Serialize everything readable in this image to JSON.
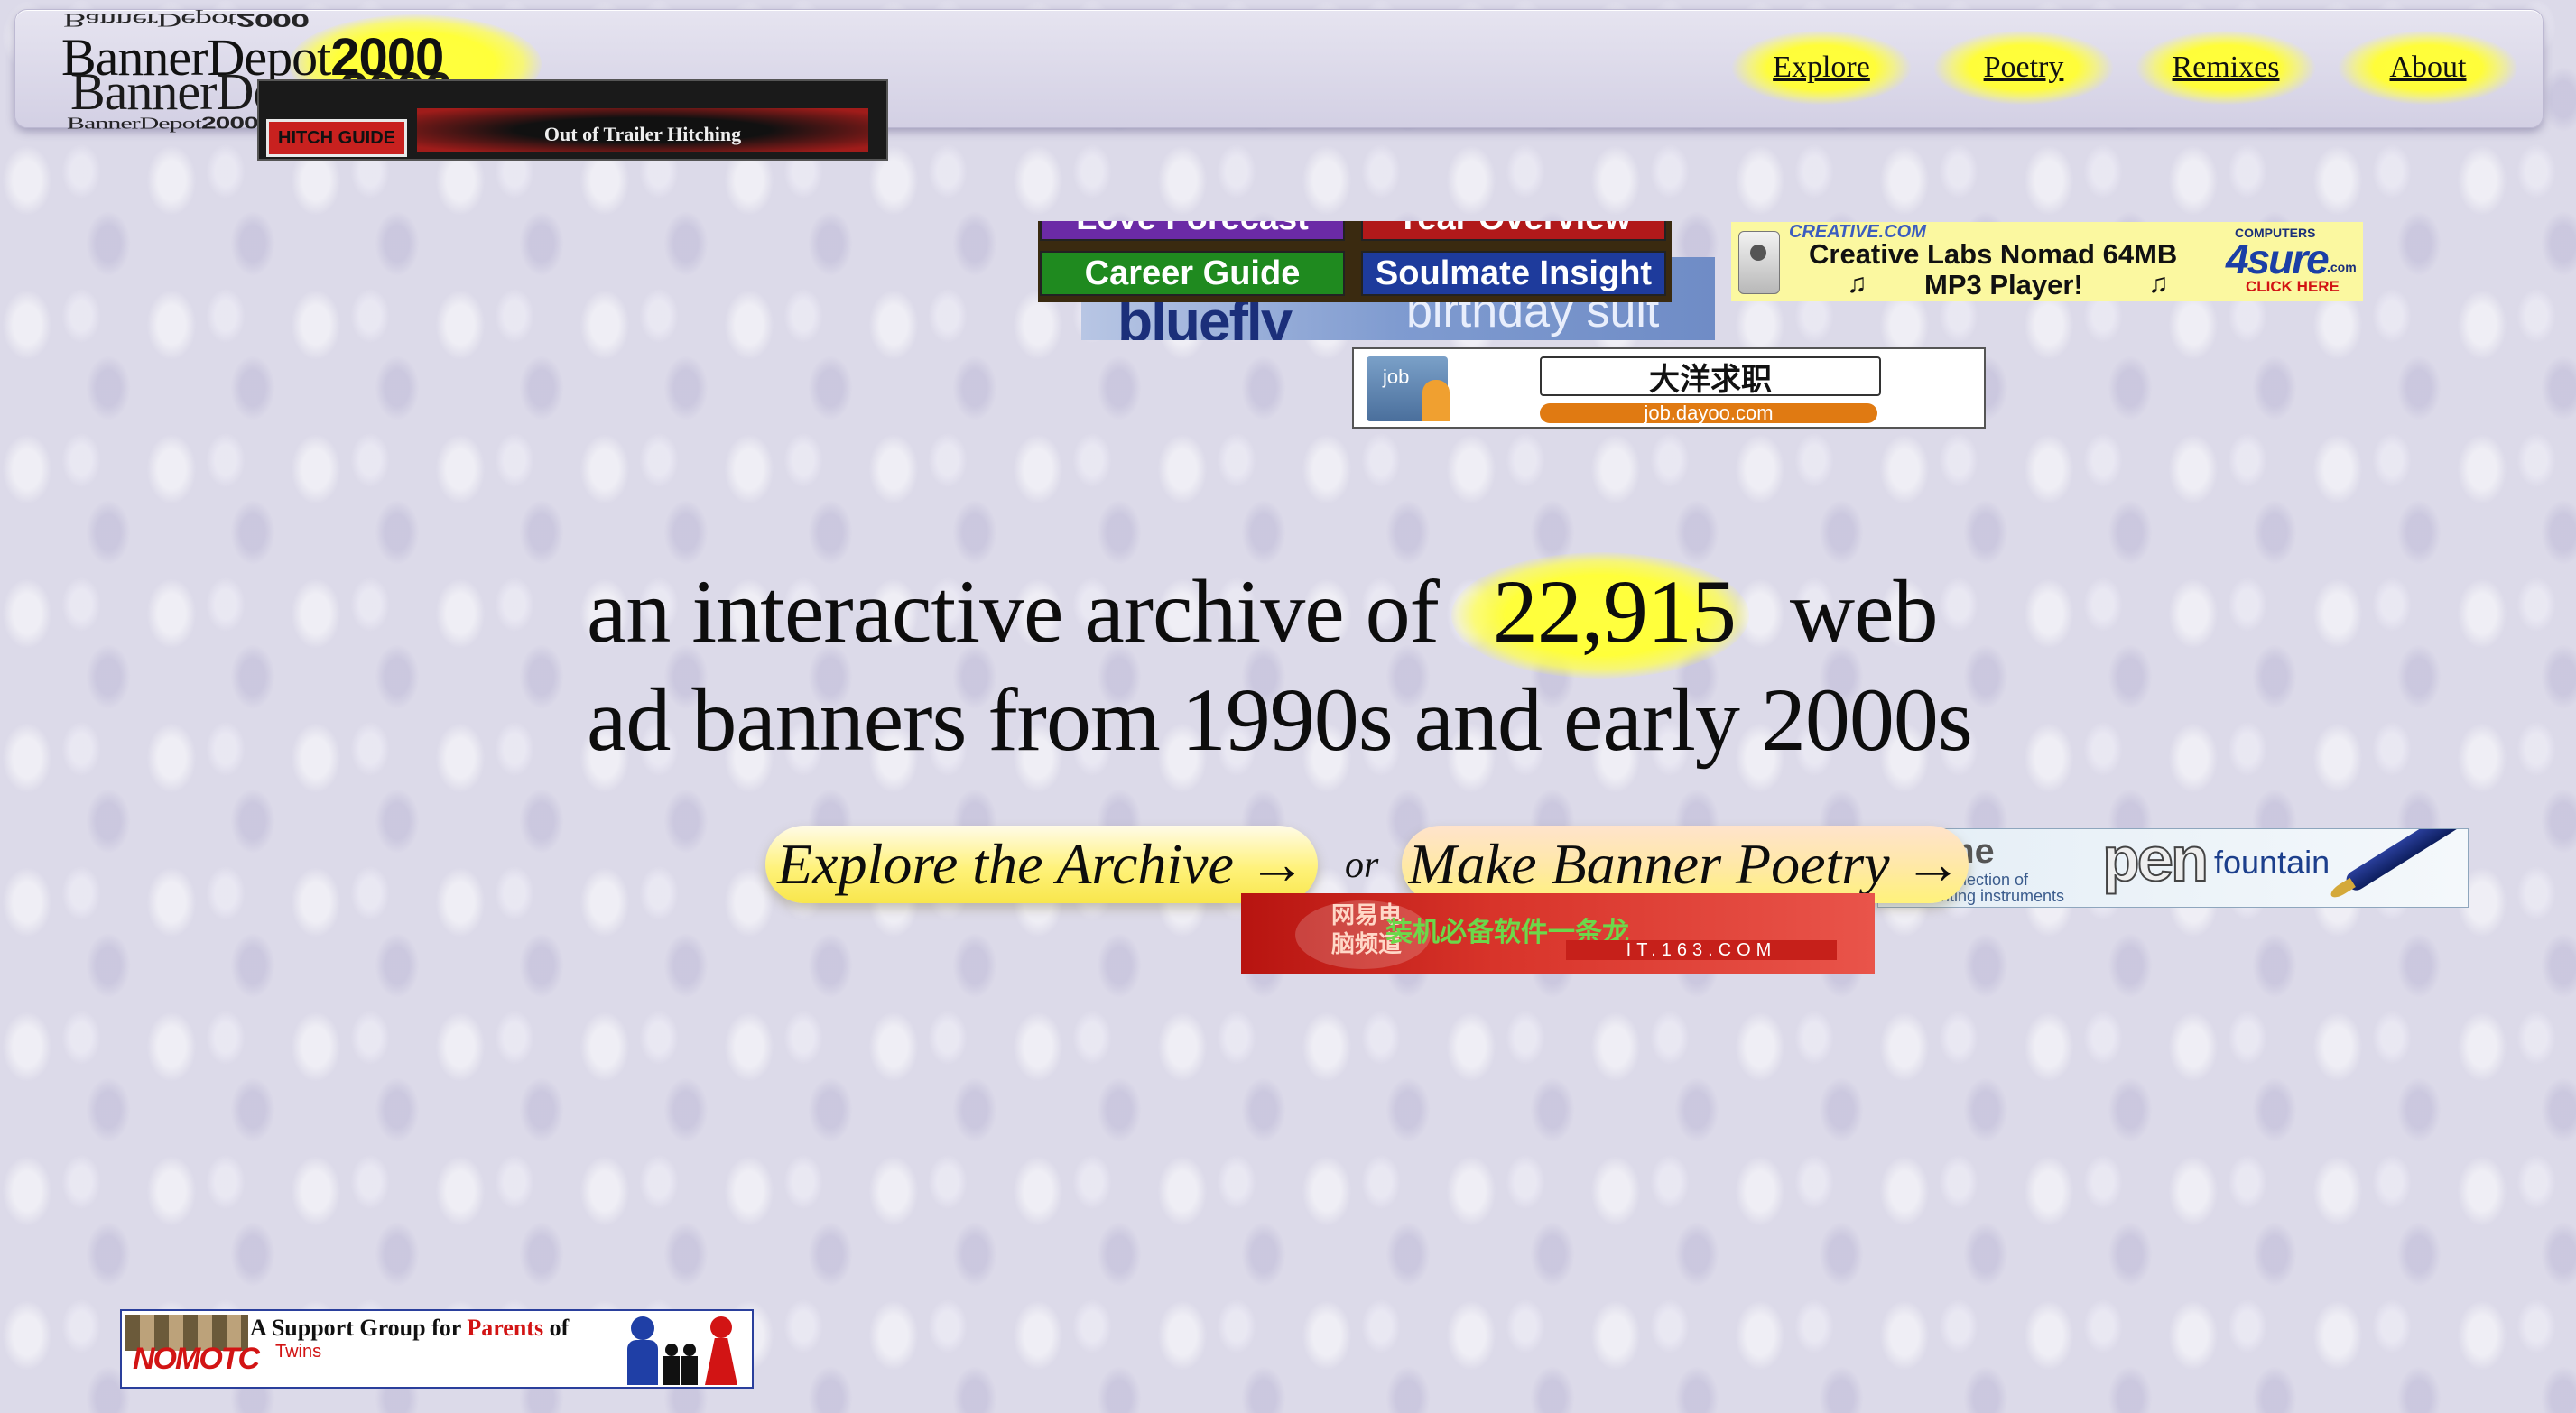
{
  "header": {
    "logo": {
      "word": "BannerDepot",
      "year": "2000"
    },
    "nav": [
      {
        "label": "Explore"
      },
      {
        "label": "Poetry"
      },
      {
        "label": "Remixes"
      },
      {
        "label": "About"
      }
    ]
  },
  "banners": {
    "hitch": {
      "left": "HITCH GUIDE",
      "right": "Out of Trailer Hitching"
    },
    "zodiac": {
      "t1": "Love Forecast",
      "t2": "Year Overview",
      "t3": "Career Guide",
      "t4": "Soulmate Insight"
    },
    "bluefly": {
      "brand": "bluefly",
      "tag": "birthday suit"
    },
    "creative": {
      "source": "CREATIVE.COM",
      "text1": "Creative Labs Nomad 64MB",
      "text2": "MP3 Player!",
      "brand": "4sure",
      "brand_top": "COMPUTERS",
      "brand_sub": ".com",
      "cta": "CLICK HERE"
    },
    "dayoo": {
      "icon_label": "job",
      "title": "大洋求职",
      "url": "job.dayoo.com"
    },
    "pen": {
      "left_top": "st selection of",
      "left_bottom": "writing instruments",
      "word": "pen",
      "right": "fountain"
    },
    "it163": {
      "logo": "网易电脑频道",
      "text": "装机必备软件一条龙",
      "url": "IT.163.COM"
    },
    "twins": {
      "logo": "NOMOTC",
      "text_pre": "A Support Group for ",
      "text_highlight": "Parents",
      "text_post": " of",
      "sub": "Twins"
    }
  },
  "hero": {
    "line1_pre": "an interactive archive of",
    "count": "22,915",
    "line1_post": "web",
    "line2": "ad banners from 1990s and early 2000s"
  },
  "cta": {
    "explore": "Explore the Archive →",
    "or": "or",
    "poetry": "Make Banner Poetry →"
  },
  "colors": {
    "highlight": "#ffff3a",
    "background": "#dcdae9"
  }
}
